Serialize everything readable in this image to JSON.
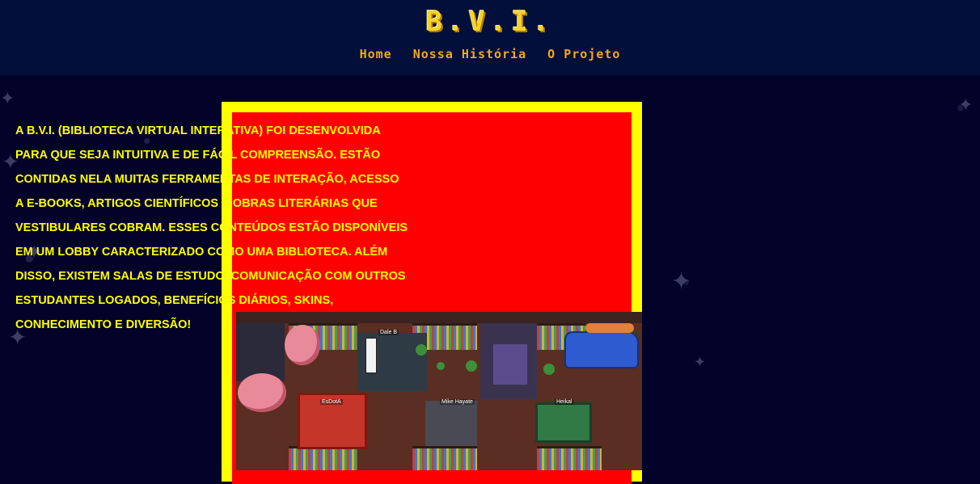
{
  "header": {
    "logo": "B.V.I.",
    "nav": [
      "Home",
      "Nossa História",
      "O Projeto"
    ]
  },
  "content": {
    "description": "A B.V.I. (Biblioteca Virtual Interativa) foi desenvolvida para que seja intuitiva e de fácil compreensão. Estão contidas nela muitas ferramentas de interação, acesso a e-books, artigos científicos e obras literárias que vestibulares cobram. Esses conteúdos estão disponíveis em um lobby caracterizado como uma biblioteca. Além disso, existem salas de estudo, comunicação com outros estudantes logados, benefícios diários, skins, conhecimento e diversão!"
  },
  "screenshot_labels": [
    "Dale B",
    "EsDotA",
    "Mike Hayate",
    "Heikal"
  ],
  "colors": {
    "background": "#03032a",
    "header": "#020f3a",
    "logo": "#f5d22c",
    "nav": "#f0a91e",
    "card_border": "#ffff00",
    "card_fill": "#ff0000",
    "text": "#ffff00"
  }
}
